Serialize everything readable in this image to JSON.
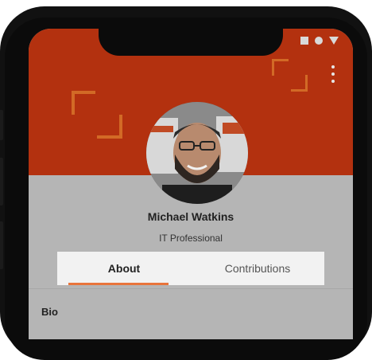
{
  "status_bar": {
    "icons": [
      "square-icon",
      "circle-icon",
      "triangle-icon"
    ]
  },
  "profile": {
    "name": "Michael Watkins",
    "role": "IT Professional"
  },
  "tabs": [
    {
      "label": "About",
      "active": true
    },
    {
      "label": "Contributions",
      "active": false
    }
  ],
  "sections": [
    {
      "title": "Bio"
    }
  ],
  "colors": {
    "header": "#b3310f",
    "accent": "#e8743b",
    "corner_decor": "#d26a26"
  }
}
